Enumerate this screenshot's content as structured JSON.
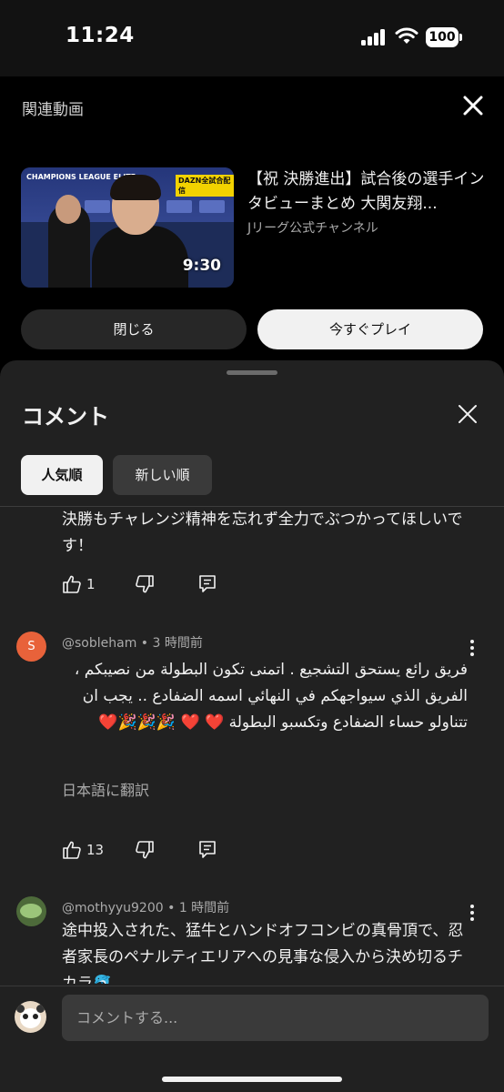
{
  "status": {
    "time": "11:24",
    "battery": "100"
  },
  "related": {
    "title": "関連動画",
    "video": {
      "title": "【祝 決勝進出】試合後の選手インタビューまとめ 大関友翔...",
      "channel": "Jリーグ公式チャンネル",
      "duration": "9:30",
      "thumb_brand": "CHAMPIONS LEAGUE ELITE",
      "thumb_tag": "DAZN全試合配信"
    },
    "close_label": "閉じる",
    "play_label": "今すぐプレイ"
  },
  "comments_sheet": {
    "title": "コメント",
    "chips": [
      "人気順",
      "新しい順"
    ],
    "comments": [
      {
        "text": "決勝もチャレンジ精神を忘れず全力でぶつかってほしいです！",
        "likes": "1"
      },
      {
        "author": "@sobleham",
        "time": "3 時間前",
        "avatar_letter": "S",
        "avatar_color": "#e8623a",
        "text": "فريق رائع يستحق التشجيع . اتمنى تكون البطولة من نصيبكم ، الفريق الذي سيواجهكم في النهائي اسمه الضفادع .. يجب ان تتناولو حساء الضفادع وتكسبو البطولة ❤️ ❤️ 🎉🎉🎉❤️",
        "translate": "日本語に翻訳",
        "likes": "13"
      },
      {
        "author": "@mothyyu9200",
        "time": "1 時間前",
        "text": "途中投入された、猛牛とハンドオフコンビの真骨頂で、忍者家長のペナルティエリアへの見事な侵入から決め切るチカラ🐬"
      }
    ],
    "composer_placeholder": "コメントする..."
  },
  "colors": {
    "sheet_bg": "#212121",
    "chip_active": "#f1f1f1",
    "chip_inactive": "#3a3a3a"
  },
  "icons": [
    "close-icon",
    "thumbs-up-icon",
    "thumbs-down-icon",
    "reply-icon",
    "more-vert-icon"
  ]
}
